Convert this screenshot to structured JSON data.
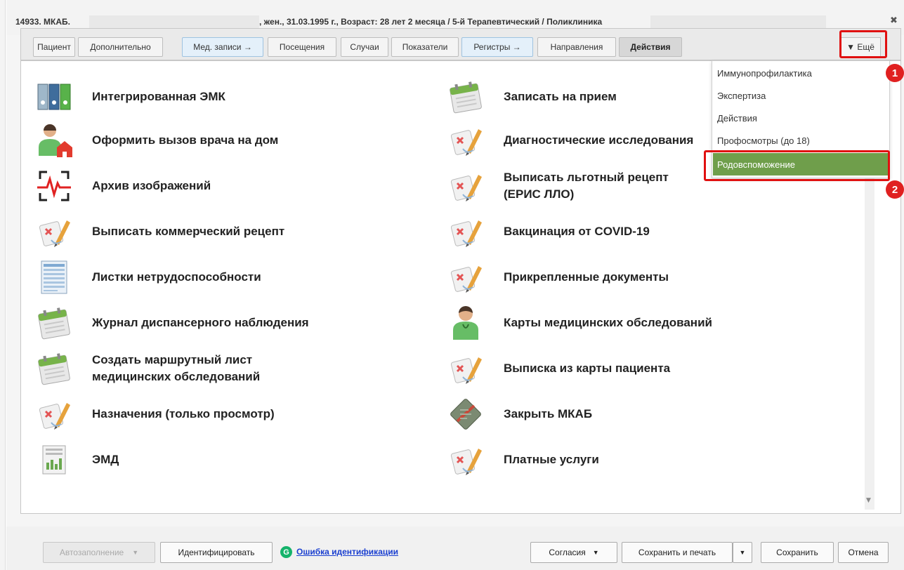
{
  "title": {
    "mkab": "14933. МКАБ.",
    "details": ", жен., 31.03.1995 г., Возраст: 28 лет 2 месяца / 5-й Терапевтический / Поликлиника"
  },
  "close_glyph": "✖",
  "tabs": [
    {
      "label": "Пациент"
    },
    {
      "label": "Дополнительно"
    },
    {
      "label": "Мед. записи →"
    },
    {
      "label": "Посещения"
    },
    {
      "label": "Случаи"
    },
    {
      "label": "Показатели"
    },
    {
      "label": "Регистры →"
    },
    {
      "label": "Направления"
    },
    {
      "label": "Действия"
    }
  ],
  "more_label": "▼ Ещё",
  "dropdown_items": [
    {
      "label": "Иммунопрофилактика"
    },
    {
      "label": "Экспертиза"
    },
    {
      "label": "Действия"
    },
    {
      "label": "Профосмотры (до 18)"
    },
    {
      "label": "Родовспоможение"
    }
  ],
  "badges": [
    "1",
    "2"
  ],
  "actions_left": [
    {
      "label": "Интегрированная ЭМК",
      "icon": "binders-icon"
    },
    {
      "label": "Оформить вызов врача на дом",
      "icon": "doctor-home-icon"
    },
    {
      "label": "Архив изображений",
      "icon": "ecg-scan-icon"
    },
    {
      "label": "Выписать коммерческий рецепт",
      "icon": "prescription-pen-icon"
    },
    {
      "label": "Листки нетрудоспособности",
      "icon": "sheet-icon"
    },
    {
      "label": "Журнал диспансерного наблюдения",
      "icon": "calendar-icon"
    },
    {
      "label": "Создать маршрутный лист\nмедицинских обследований",
      "icon": "calendar-icon"
    },
    {
      "label": "Назначения (только просмотр)",
      "icon": "prescription-pen-icon"
    },
    {
      "label": "ЭМД",
      "icon": "document-chart-icon"
    }
  ],
  "actions_right": [
    {
      "label": "Записать на прием",
      "icon": "calendar-icon"
    },
    {
      "label": "Диагностические исследования",
      "icon": "prescription-pen-icon"
    },
    {
      "label": "Выписать льготный рецепт\n(ЕРИС ЛЛО)",
      "icon": "prescription-pen-icon"
    },
    {
      "label": "Вакцинация от COVID-19",
      "icon": "prescription-pen-icon"
    },
    {
      "label": "Прикрепленные документы",
      "icon": "prescription-pen-icon"
    },
    {
      "label": "Карты медицинских обследований",
      "icon": "doctor-icon"
    },
    {
      "label": "Выписка из карты пациента",
      "icon": "prescription-pen-icon"
    },
    {
      "label": "Закрыть МКАБ",
      "icon": "closed-card-icon"
    },
    {
      "label": "Платные услуги",
      "icon": "prescription-pen-icon"
    }
  ],
  "footer": {
    "autofill": "Автозаполнение",
    "identify": "Идентифицировать",
    "g_letter": "G",
    "error_link": "Ошибка идентификации",
    "consents": "Согласия",
    "save_print": "Сохранить и печать",
    "save": "Сохранить",
    "cancel": "Отмена"
  },
  "colors": {
    "highlight": "#6f9e4b",
    "annotation_red": "#e01010",
    "link": "#1a3fd0"
  }
}
